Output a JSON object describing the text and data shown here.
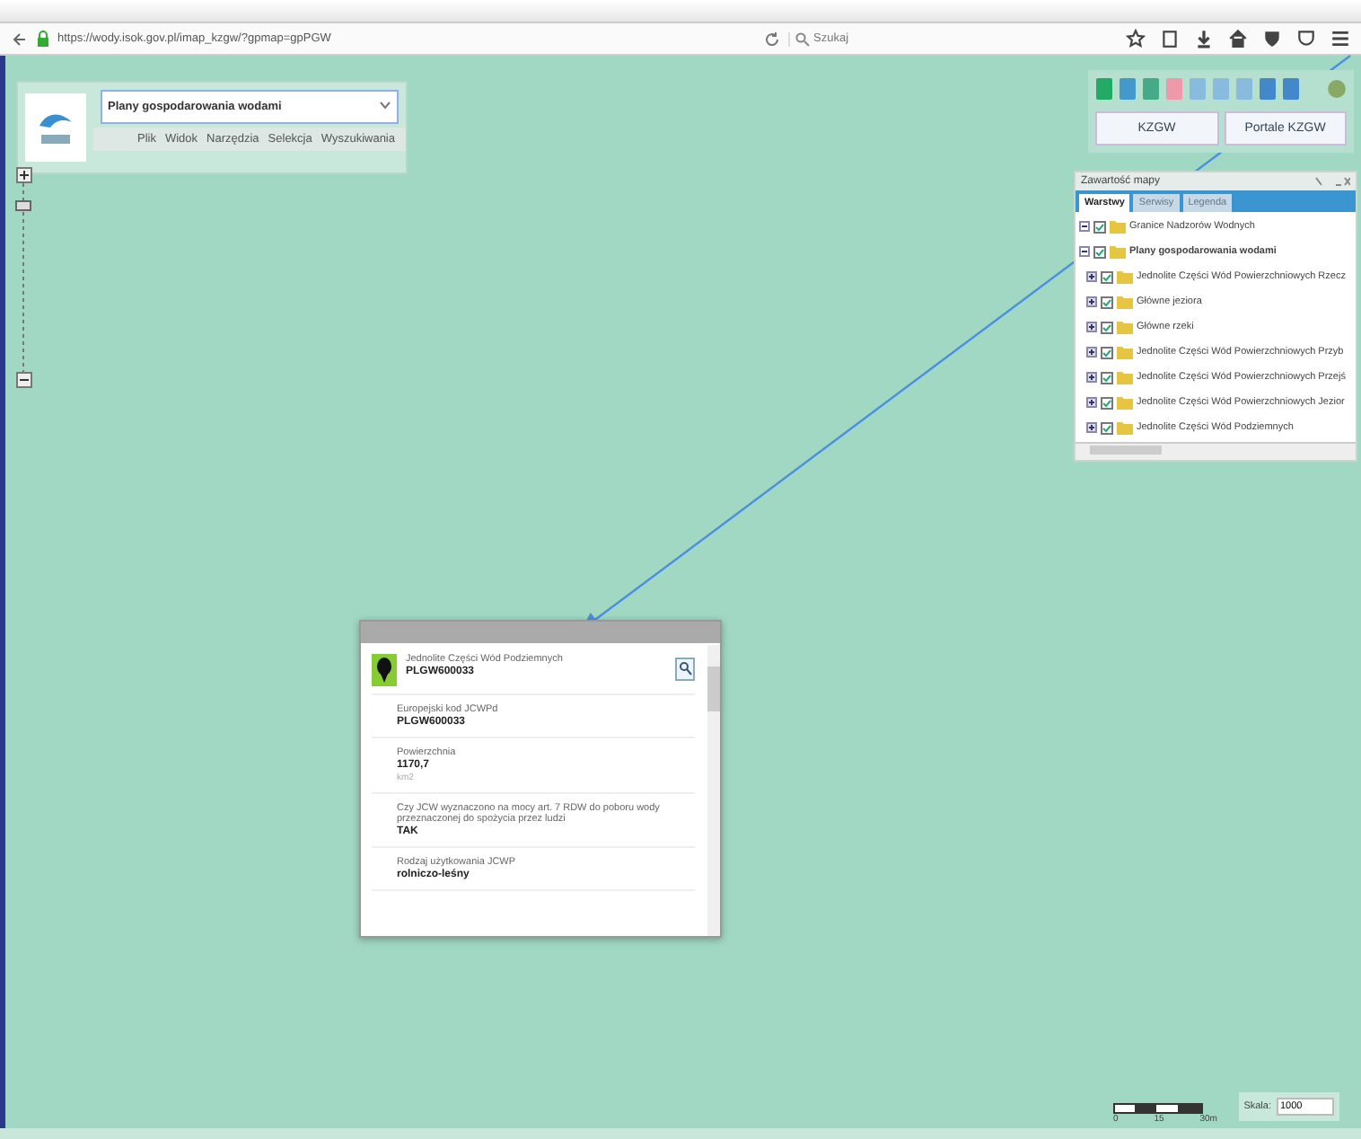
{
  "browser": {
    "url": "https://wody.isok.gov.pl/imap_kzgw/?gpmap=gpPGW",
    "search_placeholder": "Szukaj"
  },
  "app_header": {
    "map_select": "Plany gospodarowania wodami",
    "menu": [
      "Plik",
      "Widok",
      "Narzędzia",
      "Selekcja",
      "Wyszukiwania"
    ]
  },
  "toolbar": {
    "buttons": [
      "KZGW",
      "Portale KZGW"
    ]
  },
  "map_contents": {
    "title": "Zawartość mapy",
    "tabs": [
      {
        "label": "Warstwy",
        "selected": true
      },
      {
        "label": "Serwisy",
        "selected": false
      },
      {
        "label": "Legenda",
        "selected": false
      }
    ],
    "layers": [
      {
        "label": "Granice Nadzorów Wodnych",
        "checked": true,
        "bold": false
      },
      {
        "label": "Plany gospodarowania wodami",
        "checked": true,
        "bold": true,
        "children": [
          {
            "label": "Jednolite Części Wód Powierzchniowych Rzecz",
            "checked": true
          },
          {
            "label": "Główne jeziora",
            "checked": true
          },
          {
            "label": "Główne rzeki",
            "checked": true
          },
          {
            "label": "Jednolite Części Wód Powierzchniowych Przyb",
            "checked": true
          },
          {
            "label": "Jednolite Części Wód Powierzchniowych Przejś",
            "checked": true
          },
          {
            "label": "Jednolite Części Wód Powierzchniowych Jezior",
            "checked": true
          },
          {
            "label": "Jednolite Części Wód Podziemnych",
            "checked": true
          }
        ]
      }
    ]
  },
  "popup": {
    "layer": "Jednolite Części Wód Podziemnych",
    "feature": "PLGW600033",
    "fields": [
      {
        "label": "Europejski kod JCWPd",
        "value": "PLGW600033"
      },
      {
        "label": "Powierzchnia",
        "value": "1170,7",
        "unit": "km2"
      },
      {
        "label": "Czy JCW wyznaczono na mocy art. 7 RDW do poboru wody przeznaczonej do spożycia przez ludzi",
        "value": "TAK"
      },
      {
        "label": "Rodzaj użytkowania JCWP",
        "value": "rolniczo-leśny"
      }
    ]
  },
  "scale": {
    "ticks": [
      "0",
      "15",
      "30m"
    ],
    "label": "Skala:",
    "value": "1000"
  }
}
